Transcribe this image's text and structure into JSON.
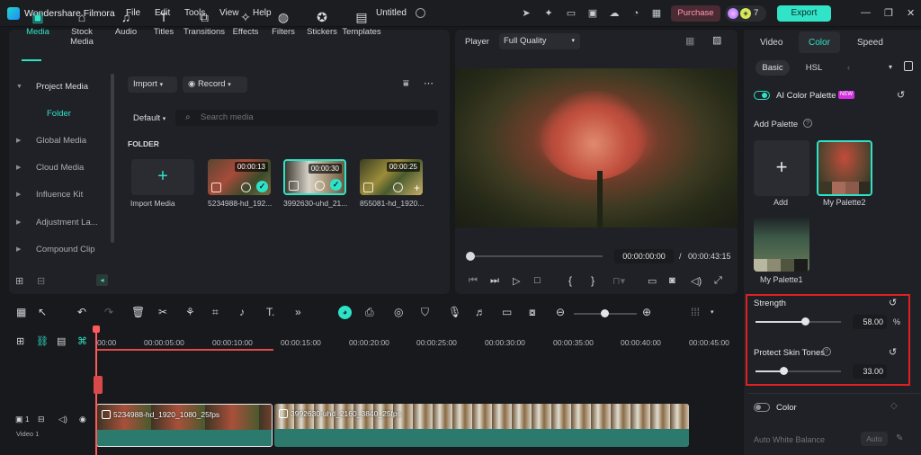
{
  "app": {
    "name": "Wondershare Filmora",
    "doc_title": "Untitled"
  },
  "menu": [
    "File",
    "Edit",
    "Tools",
    "View",
    "Help"
  ],
  "titlebar": {
    "purchase": "Purchase",
    "credits": "7",
    "export": "Export"
  },
  "media_tabs": [
    "Media",
    "Stock Media",
    "Audio",
    "Titles",
    "Transitions",
    "Effects",
    "Filters",
    "Stickers",
    "Templates"
  ],
  "sidebar": {
    "items": [
      "Project Media",
      "Folder",
      "Global Media",
      "Cloud Media",
      "Influence Kit",
      "Adjustment La...",
      "Compound Clip"
    ]
  },
  "media": {
    "import_label": "Import",
    "record_label": "Record",
    "sort": "Default",
    "search_placeholder": "Search media",
    "folder_label": "FOLDER",
    "import_media": "Import Media",
    "clips": [
      {
        "name": "5234988-hd_192...",
        "duration": "00:00:13"
      },
      {
        "name": "3992630-uhd_21...",
        "duration": "00:00:30"
      },
      {
        "name": "855081-hd_1920...",
        "duration": "00:00:25"
      }
    ]
  },
  "player": {
    "label": "Player",
    "quality": "Full Quality",
    "current": "00:00:00:00",
    "separator": "/",
    "total": "00:00:43:15"
  },
  "right": {
    "tabs": [
      "Video",
      "Color",
      "Speed"
    ],
    "subtabs": [
      "Basic",
      "HSL"
    ],
    "ai_palette": "AI Color Palette",
    "new_badge": "NEW",
    "add_palette": "Add Palette",
    "palettes": [
      {
        "label": "Add"
      },
      {
        "label": "My Palette2"
      },
      {
        "label": "My Palette1"
      }
    ],
    "strength": {
      "label": "Strength",
      "value": "58.00",
      "unit": "%",
      "level": 0.58
    },
    "skin": {
      "label": "Protect Skin Tones",
      "value": "33.00",
      "level": 0.33
    },
    "color_label": "Color",
    "auto_wb": "Auto White Balance",
    "auto_btn": "Auto"
  },
  "timeline": {
    "ticks": [
      "00:00",
      "00:00:05:00",
      "00:00:10:00",
      "00:00:15:00",
      "00:00:20:00",
      "00:00:25:00",
      "00:00:30:00",
      "00:00:35:00",
      "00:00:40:00",
      "00:00:45:00"
    ],
    "track": {
      "number": "1",
      "name": "Video 1"
    },
    "clips": [
      "5234988-hd_1920_1080_25fps",
      "3992630-uhd_2160_3840_25fps"
    ]
  }
}
